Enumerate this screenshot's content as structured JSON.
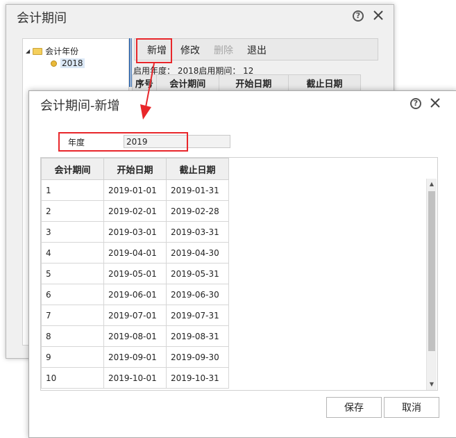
{
  "back_window": {
    "title": "会计期间",
    "tree": {
      "root_label": "会计年份",
      "child_label": "2018"
    },
    "toolbar": {
      "add_label": "新增",
      "edit_label": "修改",
      "delete_label": "删除",
      "exit_label": "退出"
    },
    "info_line": "启用年度： 2018启用期间： 12",
    "columns": [
      "序号",
      "会计期间",
      "开始日期",
      "截止日期"
    ]
  },
  "dialog": {
    "title": "会计期间-新增",
    "year_label": "年度",
    "year_value": "2019",
    "columns": [
      "会计期间",
      "开始日期",
      "截止日期"
    ],
    "rows": [
      [
        "1",
        "2019-01-01",
        "2019-01-31"
      ],
      [
        "2",
        "2019-02-01",
        "2019-02-28"
      ],
      [
        "3",
        "2019-03-01",
        "2019-03-31"
      ],
      [
        "4",
        "2019-04-01",
        "2019-04-30"
      ],
      [
        "5",
        "2019-05-01",
        "2019-05-31"
      ],
      [
        "6",
        "2019-06-01",
        "2019-06-30"
      ],
      [
        "7",
        "2019-07-01",
        "2019-07-31"
      ],
      [
        "8",
        "2019-08-01",
        "2019-08-31"
      ],
      [
        "9",
        "2019-09-01",
        "2019-09-30"
      ],
      [
        "10",
        "2019-10-01",
        "2019-10-31"
      ]
    ],
    "save_label": "保存",
    "cancel_label": "取消"
  },
  "icons": {
    "help": "help-icon",
    "close": "close-icon",
    "folder": "folder-icon",
    "tree_node": "tree-node-icon",
    "arrow": "red-arrow-icon"
  },
  "colors": {
    "highlight_red": "#e8262a",
    "splitter_blue": "#3a6fb2",
    "folder_yellow": "#f4cf5c"
  }
}
